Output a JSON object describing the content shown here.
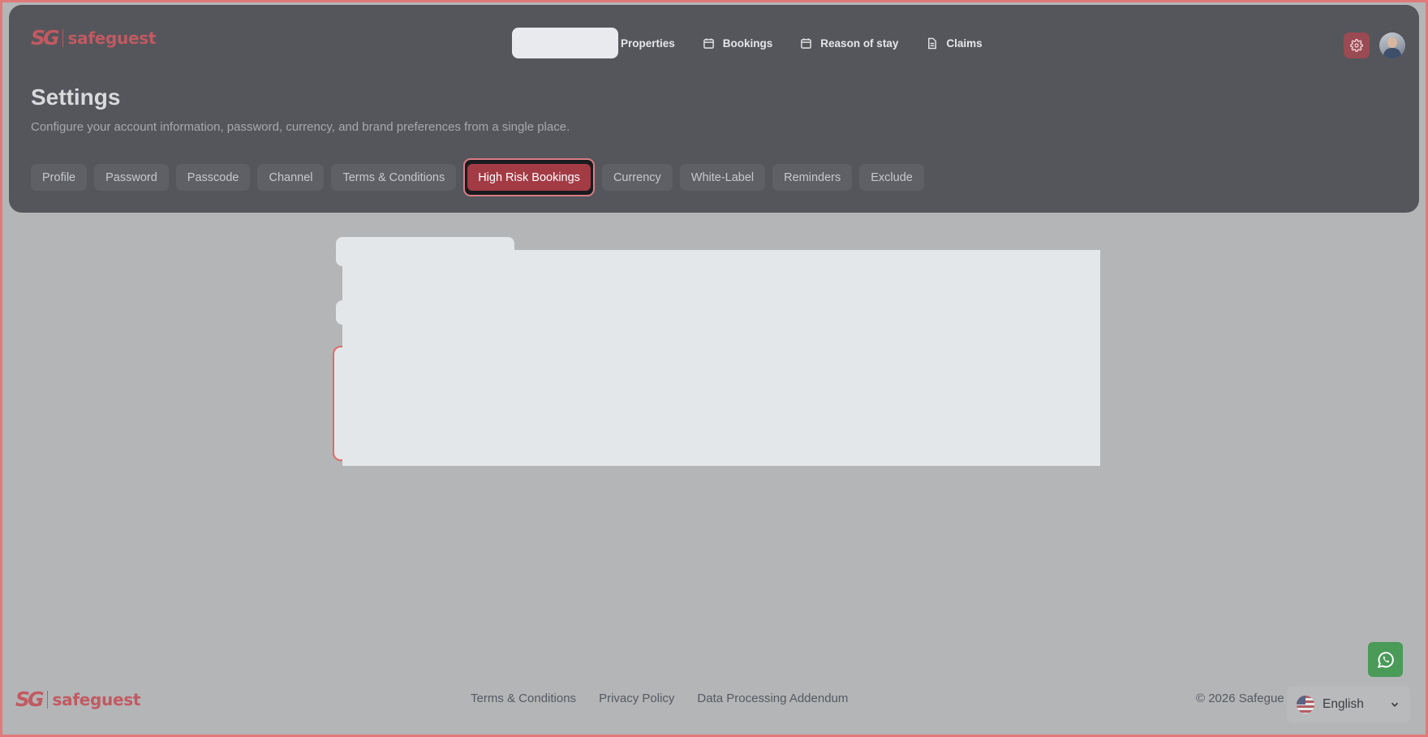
{
  "brand": {
    "mark": "SG",
    "name": "safeguest"
  },
  "nav": {
    "items": [
      {
        "label": "Properties",
        "icon": "none"
      },
      {
        "label": "Bookings",
        "icon": "calendar-icon"
      },
      {
        "label": "Reason of stay",
        "icon": "calendar-icon"
      },
      {
        "label": "Claims",
        "icon": "document-icon"
      }
    ]
  },
  "header": {
    "title": "Settings",
    "subtitle": "Configure your account information, password, currency, and brand preferences from a single place."
  },
  "tabs": [
    {
      "label": "Profile"
    },
    {
      "label": "Password"
    },
    {
      "label": "Passcode"
    },
    {
      "label": "Channel"
    },
    {
      "label": "Terms & Conditions"
    },
    {
      "label": "High Risk Bookings",
      "active": true
    },
    {
      "label": "Currency"
    },
    {
      "label": "White-Label"
    },
    {
      "label": "Reminders"
    },
    {
      "label": "Exclude"
    }
  ],
  "footer": {
    "links": [
      "Terms & Conditions",
      "Privacy Policy",
      "Data Processing Addendum"
    ],
    "copyright": "© 2026 Safegue"
  },
  "language": {
    "selected": "English"
  },
  "colors": {
    "accent": "#a33b45",
    "brand": "#c15a62",
    "header_bg": "#54565b",
    "page_bg": "#b4b5b6",
    "whatsapp": "#4a9a58"
  }
}
